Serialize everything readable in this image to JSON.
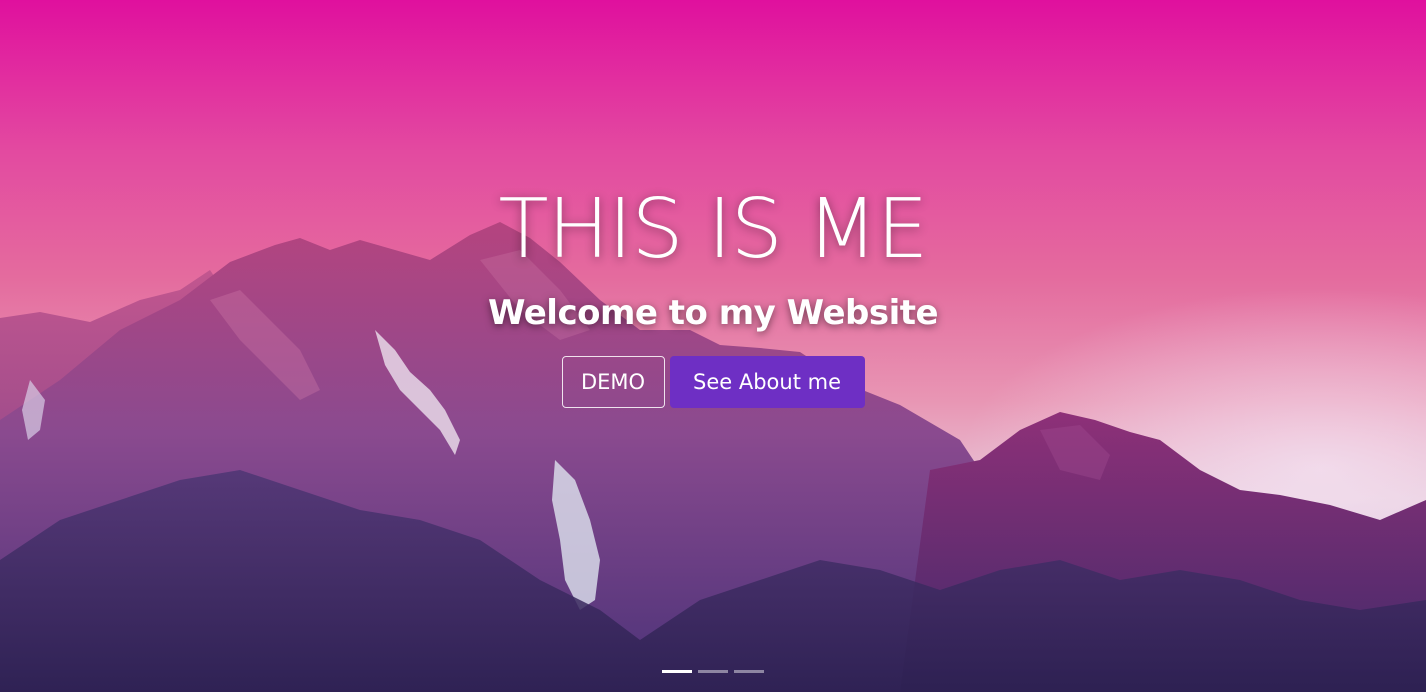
{
  "hero": {
    "title": "THIS IS ME",
    "subtitle": "Welcome to my Website",
    "buttons": {
      "demo_label": "DEMO",
      "about_label": "See About me"
    },
    "background_image": "mountains-at-dusk",
    "carousel": {
      "slide_count": 3,
      "active_index": 0
    }
  },
  "colors": {
    "primary_button": "#6e2fc4",
    "sky_top": "#e0109e",
    "sky_horizon": "#e7c7d8",
    "mountain_shadow": "#3d2a6e"
  }
}
